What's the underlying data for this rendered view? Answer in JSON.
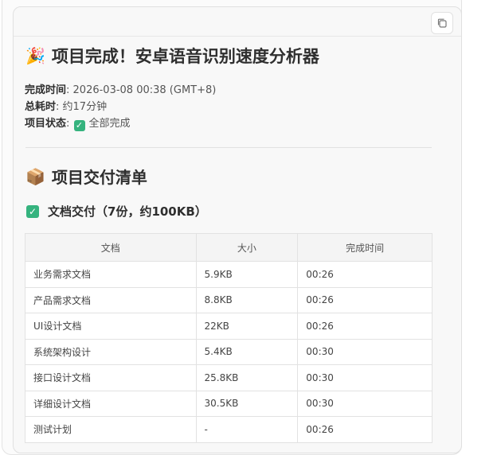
{
  "title": "项目完成！安卓语音识别速度分析器",
  "title_icon": "party-popper-icon",
  "meta": {
    "completion_time_label": "完成时间",
    "completion_time_value": "2026-03-08 00:38 (GMT+8)",
    "duration_label": "总耗时",
    "duration_value": "约17分钟",
    "status_label": "项目状态",
    "status_value": "全部完成"
  },
  "section": {
    "heading": "项目交付清单",
    "heading_icon": "package-icon",
    "subheading": "文档交付（7份，约100KB）"
  },
  "table": {
    "headers": [
      "文档",
      "大小",
      "完成时间"
    ],
    "rows": [
      [
        "业务需求文档",
        "5.9KB",
        "00:26"
      ],
      [
        "产品需求文档",
        "8.8KB",
        "00:26"
      ],
      [
        "UI设计文档",
        "22KB",
        "00:26"
      ],
      [
        "系统架构设计",
        "5.4KB",
        "00:30"
      ],
      [
        "接口设计文档",
        "25.8KB",
        "00:30"
      ],
      [
        "详细设计文档",
        "30.5KB",
        "00:30"
      ],
      [
        "测试计划",
        "-",
        "00:26"
      ]
    ]
  },
  "colors": {
    "check_green": "#35b37e",
    "border": "#e2e2e2",
    "header_bg": "#f4f4f4"
  }
}
